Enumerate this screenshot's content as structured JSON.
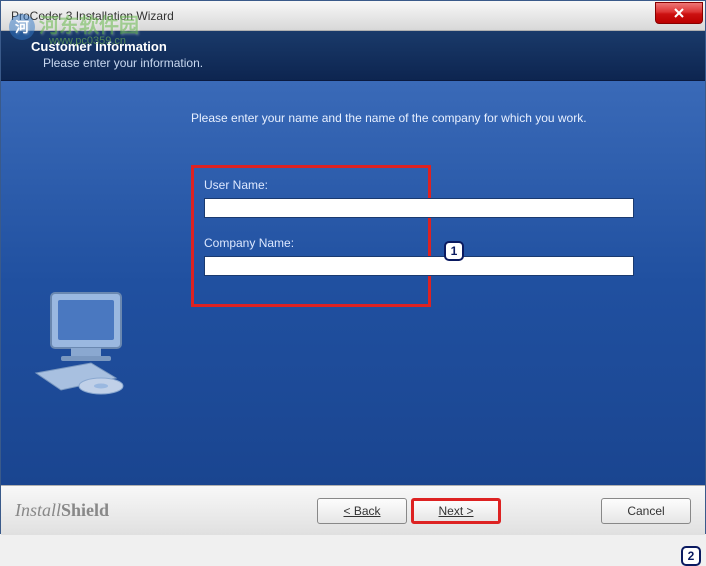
{
  "window": {
    "title": "ProCoder 3 Installation Wizard"
  },
  "header": {
    "title": "Customer Information",
    "subtitle": "Please enter your information."
  },
  "main": {
    "instruction": "Please enter your name and the name of the company for which you work.",
    "user_name_label": "User Name:",
    "user_name_value": "",
    "company_name_label": "Company Name:",
    "company_name_value": ""
  },
  "footer": {
    "brand": "InstallShield",
    "back_label": "< Back",
    "next_label": "Next >",
    "cancel_label": "Cancel"
  },
  "annotations": {
    "badge1": "1",
    "badge2": "2"
  },
  "watermark": {
    "text": "河东软件园",
    "url": "www.pc0359.cn"
  }
}
